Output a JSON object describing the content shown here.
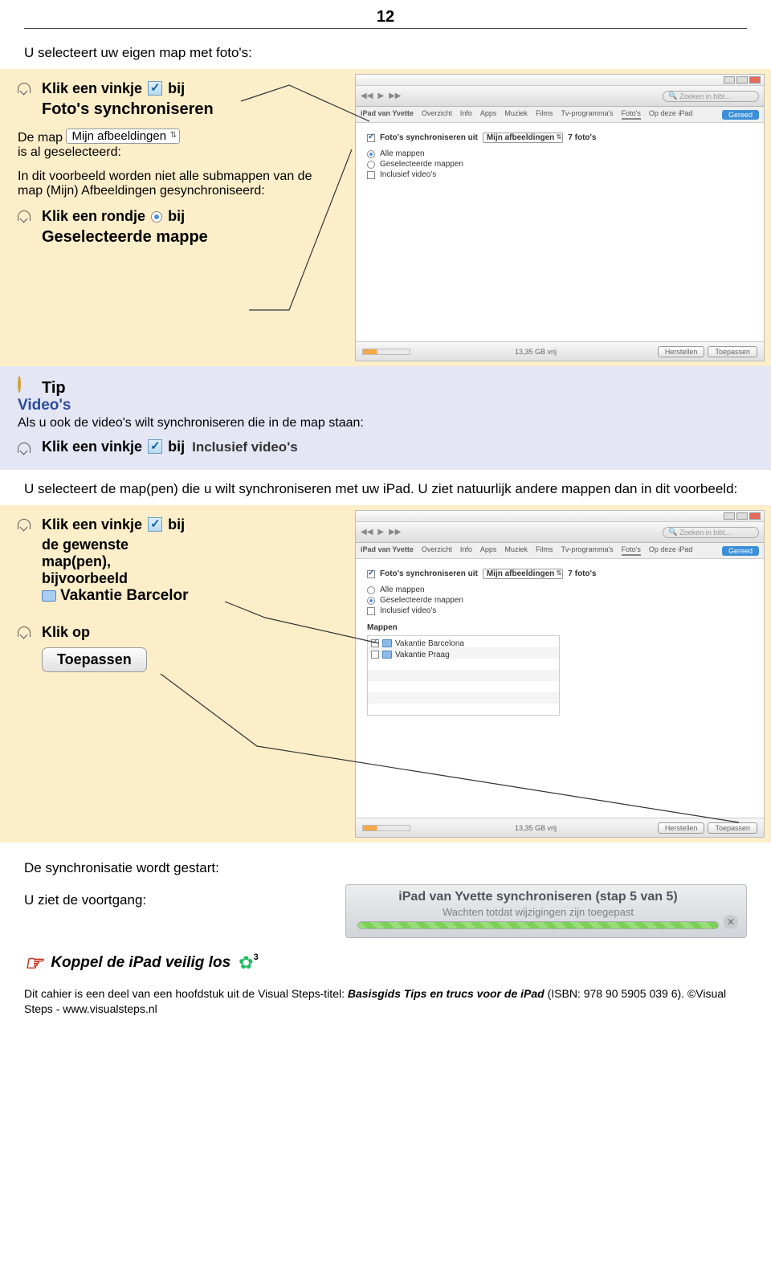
{
  "page_number": "12",
  "intro": "U selecteert uw eigen map met foto's:",
  "block1": {
    "line1_a": "Klik een vinkje",
    "line1_b": "bij",
    "line2": "Foto's synchroniseren",
    "text_a": "De map",
    "dropdown": "Mijn afbeeldingen",
    "text_b": "is al geselecteerd:",
    "para2": "In dit voorbeeld worden niet alle submappen van de map (Mijn) Afbeeldingen gesynchroniseerd:",
    "line3_a": "Klik een rondje",
    "line3_b": "bij",
    "line4": "Geselecteerde mappe"
  },
  "itunes1": {
    "search_placeholder": "Zoeken in bibl...",
    "device": "iPad van Yvette",
    "tabs": [
      "Overzicht",
      "Info",
      "Apps",
      "Muziek",
      "Films",
      "Tv-programma's",
      "Foto's",
      "Op deze iPad"
    ],
    "ready": "Gereed",
    "sync_label": "Foto's synchroniseren uit",
    "sync_dd": "Mijn afbeeldingen",
    "sync_count": "7 foto's",
    "opt_all": "Alle mappen",
    "opt_sel": "Geselecteerde mappen",
    "opt_vid": "Inclusief video's",
    "radio_all": true,
    "radio_sel": false,
    "free": "13,35 GB vrij",
    "btn_restore": "Herstellen",
    "btn_apply": "Toepassen"
  },
  "tip": {
    "title": "Tip",
    "subtitle": "Video's",
    "text": "Als u ook de video's wilt synchroniseren die in de map staan:",
    "instr_a": "Klik een vinkje",
    "instr_b": "bij",
    "instr_label": "Inclusief video's"
  },
  "mid_para": "U selecteert de map(pen) die u wilt synchroniseren met uw iPad. U ziet natuurlijk andere mappen dan in dit voorbeeld:",
  "block2": {
    "line1_a": "Klik een vinkje",
    "line1_b": "bij",
    "line2": "de gewenste",
    "line3": "map(pen),",
    "line4": "bijvoorbeeld",
    "folder": "Vakantie Barcelor",
    "line5": "Klik op",
    "btn": "Toepassen"
  },
  "itunes2": {
    "radio_all": false,
    "radio_sel": true,
    "chk_vid": false,
    "section": "Mappen",
    "folders": [
      {
        "name": "Vakantie Barcelona",
        "checked": true
      },
      {
        "name": "Vakantie Praag",
        "checked": false
      }
    ]
  },
  "after2": "De synchronisatie wordt gestart:",
  "progress": {
    "left": "U ziet de voortgang:",
    "line1": "iPad van Yvette synchroniseren (stap 5 van 5)",
    "line2": "Wachten totdat wijzigingen zijn toegepast"
  },
  "hand_line": "Koppel de iPad veilig los",
  "hand_ref": "3",
  "footer_a": "Dit cahier is een deel van een hoofdstuk uit de Visual Steps-titel: ",
  "footer_b": "Basisgids Tips en trucs voor de iPad",
  "footer_c": " (ISBN: 978 90 5905 039 6). ©Visual Steps - www.visualsteps.nl"
}
